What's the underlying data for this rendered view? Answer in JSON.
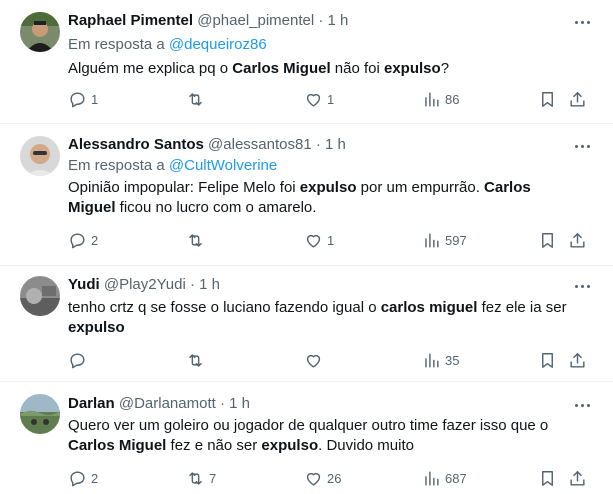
{
  "tweets": [
    {
      "name": "Raphael Pimentel",
      "handle": "@phael_pimentel",
      "dot": "·",
      "time": "1 h",
      "reply_prefix": "Em resposta a",
      "reply_to": "@dequeiroz86",
      "body": [
        [
          {
            "t": "Alguém me explica pq o ",
            "b": false
          },
          {
            "t": "Carlos Miguel",
            "b": true
          },
          {
            "t": " não foi ",
            "b": false
          },
          {
            "t": "expulso",
            "b": true
          },
          {
            "t": "?",
            "b": false
          }
        ]
      ],
      "replies": "1",
      "retweets": "",
      "likes": "1",
      "views": "86"
    },
    {
      "name": "Alessandro Santos",
      "handle": "@alessantos81",
      "dot": "·",
      "time": "1 h",
      "reply_prefix": "Em resposta a",
      "reply_to": "@CultWolverine",
      "body": [
        [
          {
            "t": "Opinião impopular: Felipe Melo foi ",
            "b": false
          },
          {
            "t": "expulso",
            "b": true
          },
          {
            "t": " por um empurrão. ",
            "b": false
          },
          {
            "t": "Carlos",
            "b": true
          }
        ],
        [
          {
            "t": "Miguel",
            "b": true
          },
          {
            "t": " ficou no lucro com o amarelo.",
            "b": false
          }
        ]
      ],
      "replies": "2",
      "retweets": "",
      "likes": "1",
      "views": "597"
    },
    {
      "name": "Yudi",
      "handle": "@Play2Yudi",
      "dot": "·",
      "time": "1 h",
      "reply_prefix": "",
      "reply_to": "",
      "body": [
        [
          {
            "t": "tenho crtz q se fosse o luciano fazendo igual o ",
            "b": false
          },
          {
            "t": "carlos miguel",
            "b": true
          },
          {
            "t": " fez ele ia ser",
            "b": false
          }
        ],
        [
          {
            "t": "expulso",
            "b": true
          }
        ]
      ],
      "replies": "",
      "retweets": "",
      "likes": "",
      "views": "35"
    },
    {
      "name": "Darlan",
      "handle": "@Darlanamott",
      "dot": "·",
      "time": "1 h",
      "reply_prefix": "",
      "reply_to": "",
      "body": [
        [
          {
            "t": "Quero ver um goleiro ou jogador de qualquer outro time fazer isso que o",
            "b": false
          }
        ],
        [
          {
            "t": "Carlos Miguel",
            "b": true
          },
          {
            "t": " fez e não ser ",
            "b": false
          },
          {
            "t": "expulso",
            "b": true
          },
          {
            "t": ". Duvido muito",
            "b": false
          }
        ]
      ],
      "replies": "2",
      "retweets": "7",
      "likes": "26",
      "views": "687"
    }
  ],
  "icons": {
    "more": "more-icon",
    "reply": "reply-icon",
    "retweet": "retweet-icon",
    "like": "heart-icon",
    "views": "views-icon",
    "bookmark": "bookmark-icon",
    "share": "share-icon"
  },
  "colors": {
    "text": "#0f1419",
    "secondary": "#536471",
    "link": "#1d9bf0",
    "divider": "#eff3f4"
  }
}
